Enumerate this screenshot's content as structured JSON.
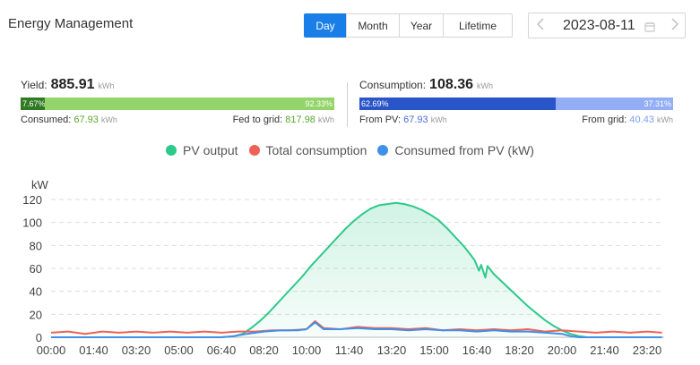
{
  "header": {
    "title": "Energy Management",
    "tabs": [
      {
        "label": "Day",
        "active": true
      },
      {
        "label": "Month",
        "active": false
      },
      {
        "label": "Year",
        "active": false
      },
      {
        "label": "Lifetime",
        "active": false
      }
    ],
    "date": "2023-08-11",
    "icons": {
      "prev": "chevron-left-icon",
      "next": "chevron-right-icon",
      "calendar": "calendar-icon"
    }
  },
  "yield": {
    "label": "Yield:",
    "value": "885.91",
    "unit": "kWh",
    "consumed_pct": "7.67%",
    "fed_pct": "92.33%",
    "consumed_fraction": 0.0767,
    "consumed_label": "Consumed:",
    "consumed_value": "67.93",
    "consumed_unit": "kWh",
    "fed_label": "Fed to grid:",
    "fed_value": "817.98",
    "fed_unit": "kWh",
    "colors": {
      "dark": "#2f7a22",
      "light": "#93d56a",
      "value": "#5aaa2e"
    }
  },
  "consumption": {
    "label": "Consumption:",
    "value": "108.36",
    "unit": "kWh",
    "pv_pct": "62.69%",
    "grid_pct": "37.31%",
    "pv_fraction": 0.6269,
    "pv_label": "From PV:",
    "pv_value": "67.93",
    "pv_unit": "kWh",
    "grid_label": "From grid:",
    "grid_value": "40.43",
    "grid_unit": "kWh",
    "colors": {
      "dark": "#2a55c8",
      "light": "#93aef5",
      "value": "#4a6fd8",
      "grid_value": "#7f9ef0"
    }
  },
  "legend": [
    {
      "label": "PV output",
      "color": "#2ec98a"
    },
    {
      "label": "Total consumption",
      "color": "#ee6256"
    },
    {
      "label": "Consumed from PV (kW)",
      "color": "#3f90e8"
    }
  ],
  "chart_data": {
    "type": "line",
    "ylabel": "kW",
    "ylim": [
      0,
      120
    ],
    "yticks": [
      "0",
      "20",
      "40",
      "60",
      "80",
      "100",
      "120"
    ],
    "xticks": [
      "00:00",
      "01:40",
      "03:20",
      "05:00",
      "06:40",
      "08:20",
      "10:00",
      "11:40",
      "13:20",
      "15:00",
      "16:40",
      "18:20",
      "20:00",
      "21:40",
      "23:20"
    ],
    "grid": true,
    "series": [
      {
        "name": "PV output",
        "color": "#2ec98a",
        "fill": true,
        "points": [
          [
            "00:00",
            0
          ],
          [
            "06:40",
            0
          ],
          [
            "07:10",
            1
          ],
          [
            "07:30",
            3
          ],
          [
            "07:50",
            8
          ],
          [
            "08:10",
            14
          ],
          [
            "08:30",
            21
          ],
          [
            "08:50",
            29
          ],
          [
            "09:10",
            37
          ],
          [
            "09:30",
            45
          ],
          [
            "09:50",
            53
          ],
          [
            "10:10",
            62
          ],
          [
            "10:30",
            70
          ],
          [
            "10:50",
            78
          ],
          [
            "11:10",
            86
          ],
          [
            "11:30",
            94
          ],
          [
            "11:50",
            101
          ],
          [
            "12:10",
            107
          ],
          [
            "12:30",
            112
          ],
          [
            "12:50",
            115
          ],
          [
            "13:10",
            116
          ],
          [
            "13:30",
            117
          ],
          [
            "13:50",
            116
          ],
          [
            "14:10",
            114
          ],
          [
            "14:30",
            111
          ],
          [
            "14:50",
            107
          ],
          [
            "15:10",
            102
          ],
          [
            "15:30",
            95
          ],
          [
            "15:50",
            87
          ],
          [
            "16:10",
            79
          ],
          [
            "16:25",
            72
          ],
          [
            "16:35",
            67
          ],
          [
            "16:45",
            58
          ],
          [
            "16:50",
            63
          ],
          [
            "17:00",
            52
          ],
          [
            "17:05",
            62
          ],
          [
            "17:20",
            55
          ],
          [
            "17:40",
            48
          ],
          [
            "18:00",
            41
          ],
          [
            "18:20",
            34
          ],
          [
            "18:40",
            27
          ],
          [
            "19:00",
            21
          ],
          [
            "19:20",
            15
          ],
          [
            "19:40",
            10
          ],
          [
            "20:00",
            6
          ],
          [
            "20:20",
            3
          ],
          [
            "20:40",
            1
          ],
          [
            "21:00",
            0
          ],
          [
            "23:55",
            0
          ]
        ]
      },
      {
        "name": "Total consumption",
        "color": "#ee6256",
        "points": [
          [
            "00:00",
            4
          ],
          [
            "00:40",
            5
          ],
          [
            "01:20",
            3
          ],
          [
            "02:00",
            5
          ],
          [
            "02:40",
            4
          ],
          [
            "03:20",
            5
          ],
          [
            "04:00",
            4
          ],
          [
            "04:40",
            5
          ],
          [
            "05:20",
            4
          ],
          [
            "06:00",
            5
          ],
          [
            "06:40",
            4
          ],
          [
            "07:20",
            5
          ],
          [
            "08:00",
            5
          ],
          [
            "08:40",
            6
          ],
          [
            "09:20",
            6
          ],
          [
            "10:00",
            7
          ],
          [
            "10:20",
            14
          ],
          [
            "10:40",
            8
          ],
          [
            "11:20",
            7
          ],
          [
            "12:00",
            9
          ],
          [
            "12:40",
            8
          ],
          [
            "13:20",
            8
          ],
          [
            "14:00",
            7
          ],
          [
            "14:40",
            8
          ],
          [
            "15:20",
            6
          ],
          [
            "16:00",
            7
          ],
          [
            "16:40",
            6
          ],
          [
            "17:20",
            7
          ],
          [
            "18:00",
            6
          ],
          [
            "18:40",
            7
          ],
          [
            "19:20",
            5
          ],
          [
            "20:00",
            6
          ],
          [
            "20:40",
            5
          ],
          [
            "21:20",
            4
          ],
          [
            "22:00",
            5
          ],
          [
            "22:40",
            4
          ],
          [
            "23:20",
            5
          ],
          [
            "23:55",
            4
          ]
        ]
      },
      {
        "name": "Consumed from PV (kW)",
        "color": "#3f90e8",
        "points": [
          [
            "00:00",
            0
          ],
          [
            "06:40",
            0
          ],
          [
            "07:10",
            1
          ],
          [
            "07:40",
            3
          ],
          [
            "08:20",
            5
          ],
          [
            "09:00",
            6
          ],
          [
            "09:40",
            6
          ],
          [
            "10:00",
            7
          ],
          [
            "10:20",
            13
          ],
          [
            "10:40",
            7
          ],
          [
            "11:20",
            7
          ],
          [
            "12:00",
            8
          ],
          [
            "12:40",
            7
          ],
          [
            "13:20",
            7
          ],
          [
            "14:00",
            6
          ],
          [
            "14:40",
            7
          ],
          [
            "15:20",
            6
          ],
          [
            "16:00",
            6
          ],
          [
            "16:40",
            5
          ],
          [
            "17:20",
            6
          ],
          [
            "18:00",
            5
          ],
          [
            "18:40",
            5
          ],
          [
            "19:20",
            4
          ],
          [
            "20:00",
            3
          ],
          [
            "20:20",
            1
          ],
          [
            "20:40",
            0
          ],
          [
            "23:55",
            0
          ]
        ]
      }
    ]
  }
}
